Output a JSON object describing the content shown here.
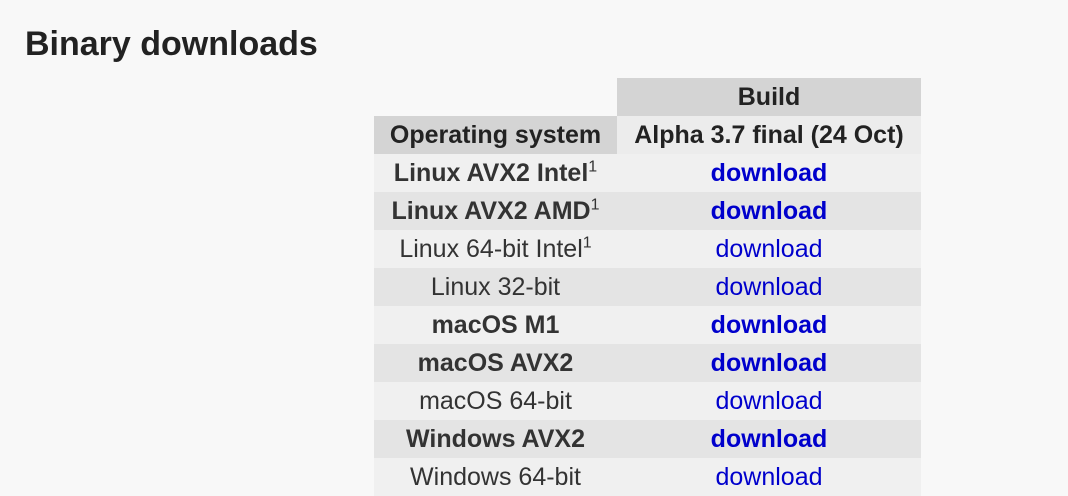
{
  "page": {
    "title": "Binary downloads"
  },
  "table": {
    "build_header": "Build",
    "os_header": "Operating system",
    "version_header": "Alpha 3.7 final (24 Oct)",
    "rows": [
      {
        "os": "Linux AVX2 Intel",
        "note": "1",
        "link": "download",
        "bold": true
      },
      {
        "os": "Linux AVX2 AMD",
        "note": "1",
        "link": "download",
        "bold": true
      },
      {
        "os": "Linux 64-bit Intel",
        "note": "1",
        "link": "download",
        "bold": false
      },
      {
        "os": "Linux 32-bit",
        "note": "",
        "link": "download",
        "bold": false
      },
      {
        "os": "macOS M1",
        "note": "",
        "link": "download",
        "bold": true
      },
      {
        "os": "macOS AVX2",
        "note": "",
        "link": "download",
        "bold": true
      },
      {
        "os": "macOS 64-bit",
        "note": "",
        "link": "download",
        "bold": false
      },
      {
        "os": "Windows AVX2",
        "note": "",
        "link": "download",
        "bold": true
      },
      {
        "os": "Windows 64-bit",
        "note": "",
        "link": "download",
        "bold": false
      }
    ]
  },
  "colors": {
    "link": "#0000cc",
    "header_bg": "#d4d4d4",
    "row_light": "#f0f0f0",
    "row_dark": "#e4e4e4"
  }
}
